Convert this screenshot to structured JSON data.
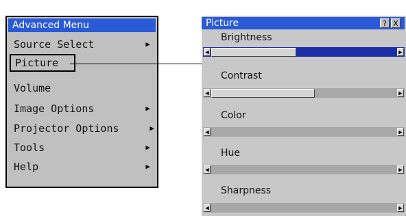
{
  "menu": {
    "title": "Advanced Menu",
    "items": [
      {
        "label": "Source Select",
        "arrow": "▶"
      },
      {
        "label": "Picture",
        "arrow": ""
      },
      {
        "label": "Volume",
        "arrow": ""
      },
      {
        "label": "Image Options",
        "arrow": "▶"
      },
      {
        "label": "Projector Options",
        "arrow": "▶"
      },
      {
        "label": "Tools",
        "arrow": "▶"
      },
      {
        "label": "Help",
        "arrow": "▶"
      }
    ]
  },
  "panel": {
    "title": "Picture",
    "help_label": "?",
    "close_label": "X",
    "adjustments": [
      {
        "label": "Brightness",
        "level": 0.45,
        "active": true
      },
      {
        "label": "Contrast",
        "level": 0.55,
        "active": false
      },
      {
        "label": "Color",
        "level": 0.0,
        "active": false
      },
      {
        "label": "Hue",
        "level": 0.0,
        "active": false
      },
      {
        "label": "Sharpness",
        "level": 0.0,
        "active": false
      }
    ],
    "arrow_left": "◀",
    "arrow_right": "▶"
  },
  "colors": {
    "title_bar": "#2a5ad8",
    "active_slider": "#1c2fa8",
    "menu_bg": "#c0c0c0"
  }
}
